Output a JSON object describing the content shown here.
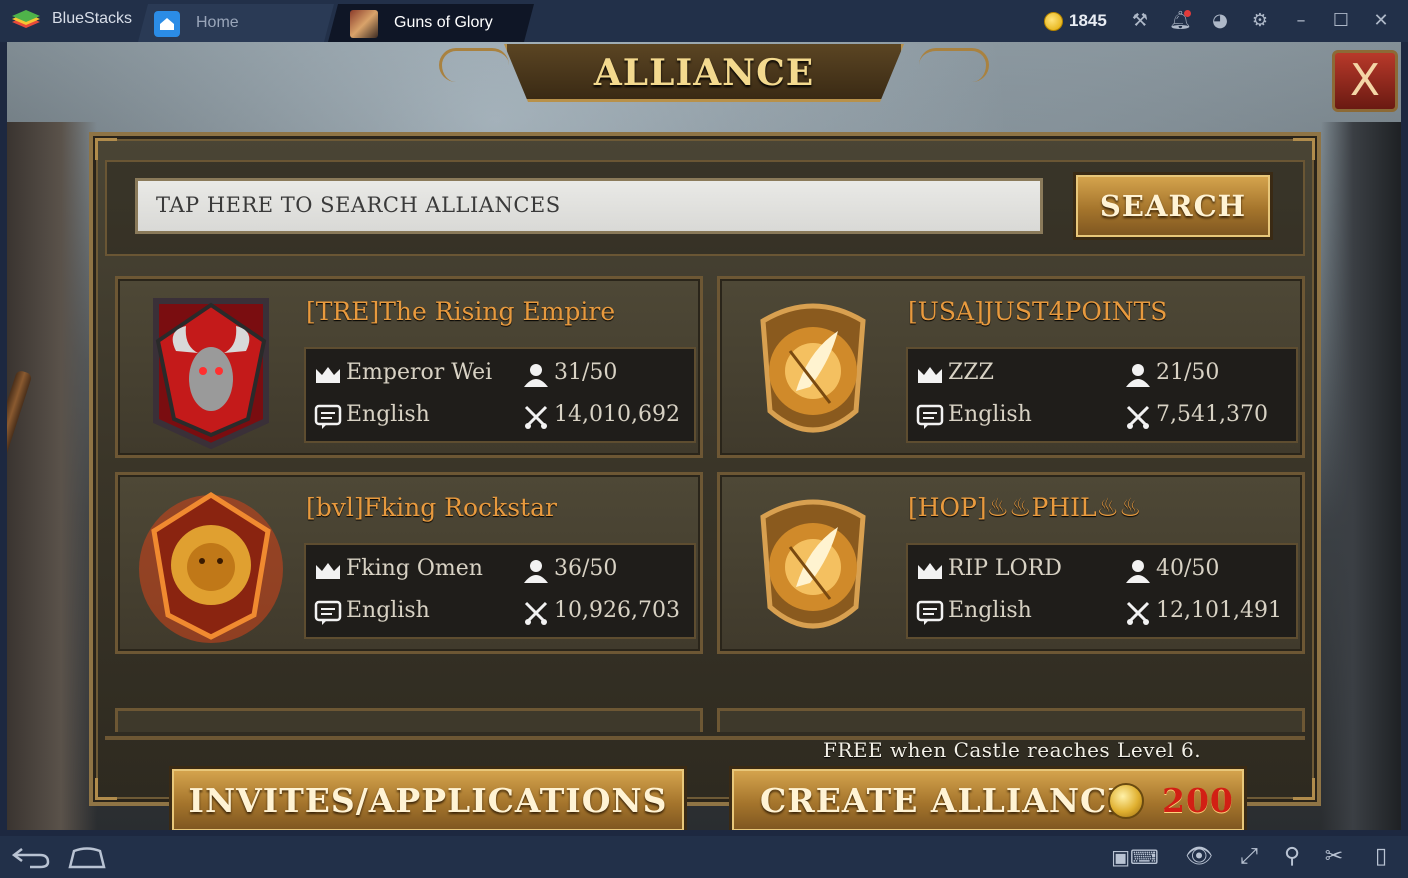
{
  "titlebar": {
    "app_name": "BlueStacks",
    "tabs": [
      {
        "label": "Home"
      },
      {
        "label": "Guns of Glory"
      }
    ],
    "coins": "1845",
    "icons": [
      "hammer-icon",
      "bell-icon",
      "account-icon",
      "settings-icon",
      "minimize-icon",
      "maximize-icon",
      "close-icon"
    ]
  },
  "game": {
    "title": "ALLIANCE",
    "close_label": "X",
    "search": {
      "placeholder": "TAP HERE TO SEARCH ALLIANCES",
      "button_label": "SEARCH"
    },
    "alliances": [
      {
        "name": "[TRE]The Rising Empire",
        "leader": "Emperor Wei",
        "members": "31/50",
        "language": "English",
        "power": "14,010,692",
        "emblem": "red-bull"
      },
      {
        "name": "[USA]JUST4POINTS",
        "leader": "ZZZ",
        "members": "21/50",
        "language": "English",
        "power": "7,541,370",
        "emblem": "gold-wing"
      },
      {
        "name": "[bvl]Fking Rockstar",
        "leader": "Fking Omen",
        "members": "36/50",
        "language": "English",
        "power": "10,926,703",
        "emblem": "fire-lion"
      },
      {
        "name": "[HOP]♨♨PHIL♨♨",
        "leader": "RIP LORD",
        "members": "40/50",
        "language": "English",
        "power": "12,101,491",
        "emblem": "gold-wing"
      }
    ],
    "free_note": "FREE when Castle reaches Level 6.",
    "invites_label": "INVITES/APPLICATIONS",
    "create_label": "CREATE ALLIANCE",
    "create_price": "200",
    "colors": {
      "name": "#e89a3e",
      "price": "#d21f14",
      "gold_button": "#a5752c"
    }
  },
  "navbar": {
    "icons": [
      "back-icon",
      "home-icon",
      "keymap-icon",
      "eye-icon",
      "fullscreen-icon",
      "location-icon",
      "scissors-icon",
      "phone-icon"
    ]
  }
}
